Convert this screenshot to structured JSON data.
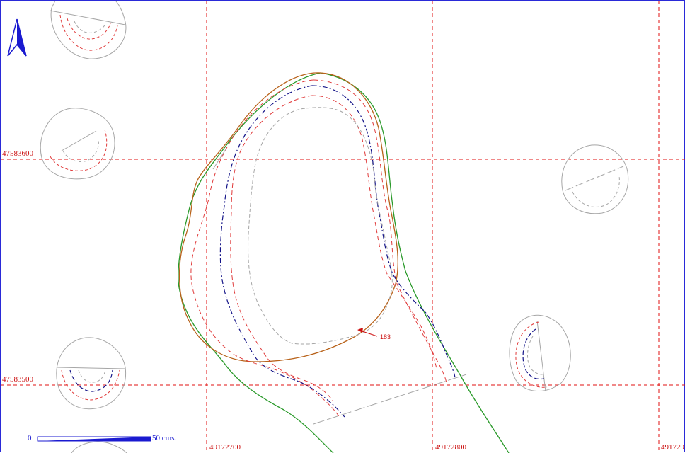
{
  "map": {
    "grid": {
      "x_labels": [
        "49172700",
        "49172800",
        "491729"
      ],
      "y_labels": [
        "47583600",
        "47583500"
      ]
    },
    "feature_label": "183",
    "scale_bar": {
      "start_label": "0",
      "end_label": "50 cms."
    },
    "colors": {
      "grid": "#e01010",
      "contour_outer": "#2a9a2a",
      "contour_pit": "#b8621a",
      "dashed_red": "#e03a3a",
      "dashed_blue": "#141488",
      "gray": "#a6a6a6",
      "frame": "#2a2ad8"
    },
    "icons": {
      "north": "north-arrow-icon"
    }
  }
}
